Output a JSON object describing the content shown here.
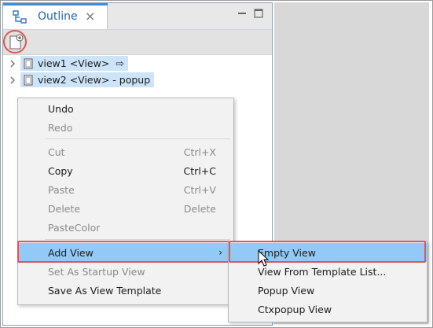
{
  "tab": {
    "title": "Outline",
    "close_glyph": "×"
  },
  "tree": [
    {
      "label": "view1 <View>",
      "suffix": "⇨"
    },
    {
      "label": "view2 <View> - popup",
      "suffix": ""
    }
  ],
  "context_menu": {
    "items": [
      {
        "label": "Undo",
        "shortcut": "",
        "enabled": true
      },
      {
        "label": "Redo",
        "shortcut": "",
        "enabled": false
      },
      {
        "label": "Cut",
        "shortcut": "Ctrl+X",
        "enabled": false
      },
      {
        "label": "Copy",
        "shortcut": "Ctrl+C",
        "enabled": true
      },
      {
        "label": "Paste",
        "shortcut": "Ctrl+V",
        "enabled": false
      },
      {
        "label": "Delete",
        "shortcut": "Delete",
        "enabled": false
      },
      {
        "label": "PasteColor",
        "shortcut": "",
        "enabled": false
      },
      {
        "label": "Add View",
        "submenu_glyph": "›",
        "enabled": true,
        "highlighted": true
      },
      {
        "label": "Set As Startup View",
        "shortcut": "",
        "enabled": false
      },
      {
        "label": "Save As View Template",
        "shortcut": "",
        "enabled": true
      }
    ]
  },
  "submenu": {
    "items": [
      {
        "label": "Empty View",
        "highlighted": true
      },
      {
        "label": "View From Template List..."
      },
      {
        "label": "Popup View"
      },
      {
        "label": "Ctxpopup View"
      }
    ]
  },
  "colors": {
    "highlight": "#91c9f7",
    "selection": "#cde3f7",
    "annotation": "#e05555",
    "tab_accent": "#3c8dde"
  }
}
